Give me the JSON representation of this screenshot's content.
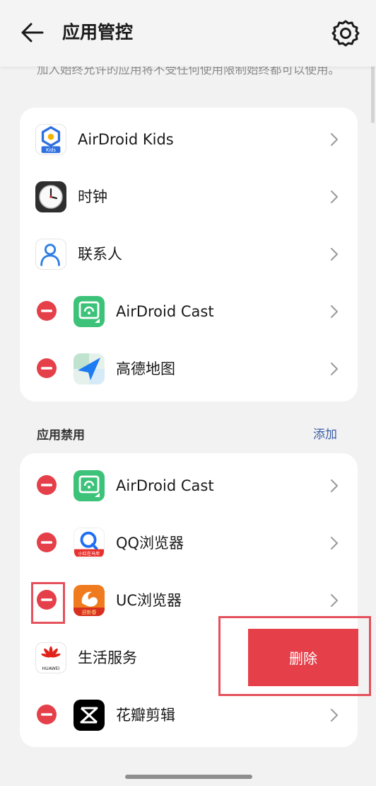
{
  "header": {
    "title": "应用管控"
  },
  "hint": "加入始终允许的应用将不受任何使用限制始终都可以使用。",
  "allowed_apps": [
    {
      "name": "AirDroid Kids",
      "icon": "airdroid-kids-icon"
    },
    {
      "name": "时钟",
      "icon": "clock-icon"
    },
    {
      "name": "联系人",
      "icon": "contacts-icon"
    },
    {
      "name": "AirDroid Cast",
      "icon": "airdroid-cast-icon"
    },
    {
      "name": "高德地图",
      "icon": "amap-icon"
    }
  ],
  "disabled_section": {
    "title": "应用禁用",
    "add_label": "添加",
    "apps": [
      {
        "name": "AirDroid Cast",
        "icon": "airdroid-cast-icon"
      },
      {
        "name": "QQ浏览器",
        "icon": "qq-browser-icon",
        "badge": "小红在马年"
      },
      {
        "name": "UC浏览器",
        "icon": "uc-browser-icon",
        "badge": "迎新春"
      },
      {
        "name": "生活服务",
        "icon": "huawei-icon",
        "badge": "HUAWEI"
      },
      {
        "name": "花瓣剪辑",
        "icon": "petal-clip-icon"
      }
    ]
  },
  "delete_label": "删除",
  "icon_badges": {
    "kids": "Kids"
  },
  "colors": {
    "accent": "#3a5ea8",
    "danger": "#e5404a",
    "highlight": "#e5515c"
  }
}
